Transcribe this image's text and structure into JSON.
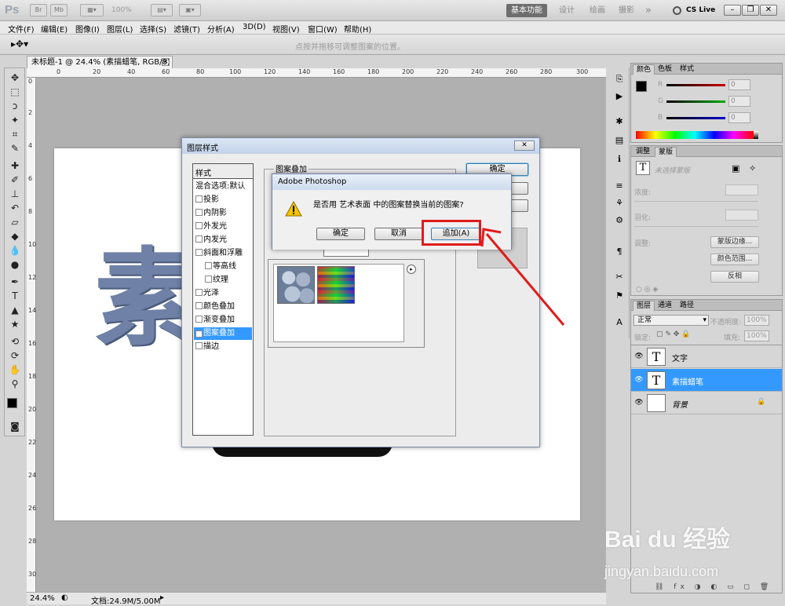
{
  "appbar": {
    "logo": "Ps",
    "zoom": "100%",
    "workspaces": [
      "基本功能",
      "设计",
      "绘画",
      "摄影"
    ],
    "more": "»",
    "cs_live": "CS Live"
  },
  "menu": [
    "文件(F)",
    "编辑(E)",
    "图像(I)",
    "图层(L)",
    "选择(S)",
    "滤镜(T)",
    "分析(A)",
    "3D(D)",
    "视图(V)",
    "窗口(W)",
    "帮助(H)"
  ],
  "options": {
    "hint": "点按并拖移可调整图案的位置。"
  },
  "document": {
    "tab_title": "未标题-1 @ 24.4% (素描蜡笔, RGB/8) *",
    "ruler_h": [
      "0",
      "20",
      "40",
      "60",
      "80",
      "100",
      "120",
      "140",
      "160",
      "180",
      "200",
      "220",
      "240",
      "260",
      "280",
      "300"
    ],
    "ruler_v": [
      "0",
      "2",
      "4",
      "6",
      "8",
      "10",
      "12",
      "14",
      "16",
      "18",
      "20",
      "22",
      "24",
      "26",
      "28",
      "30"
    ],
    "canvas_text": "素"
  },
  "status": {
    "zoom": "24.4%",
    "doc": "文档:24.9M/5.00M"
  },
  "layer_style": {
    "title": "图层样式",
    "styles_header": "样式",
    "items": [
      {
        "label": "混合选项:默认",
        "checkbox": false,
        "checked": false
      },
      {
        "label": "投影",
        "checkbox": true,
        "checked": false
      },
      {
        "label": "内阴影",
        "checkbox": true,
        "checked": false
      },
      {
        "label": "外发光",
        "checkbox": true,
        "checked": false
      },
      {
        "label": "内发光",
        "checkbox": true,
        "checked": false
      },
      {
        "label": "斜面和浮雕",
        "checkbox": true,
        "checked": false
      },
      {
        "label": "等高线",
        "checkbox": true,
        "checked": false
      },
      {
        "label": "纹理",
        "checkbox": true,
        "checked": false
      },
      {
        "label": "光泽",
        "checkbox": true,
        "checked": false
      },
      {
        "label": "颜色叠加",
        "checkbox": true,
        "checked": false
      },
      {
        "label": "渐变叠加",
        "checkbox": true,
        "checked": false
      },
      {
        "label": "图案叠加",
        "checkbox": true,
        "checked": true,
        "selected": true
      },
      {
        "label": "描边",
        "checkbox": true,
        "checked": false
      }
    ],
    "group_title": "图案叠加",
    "ok": "确定"
  },
  "alert": {
    "title": "Adobe Photoshop",
    "message": "是否用 艺术表面 中的图案替换当前的图案?",
    "ok": "确定",
    "cancel": "取消",
    "append": "追加(A)"
  },
  "color_panel": {
    "tabs": [
      "颜色",
      "色板",
      "样式"
    ],
    "channels": [
      {
        "letter": "R",
        "value": "0",
        "color": "#cc0000"
      },
      {
        "letter": "G",
        "value": "0",
        "color": "#00aa00"
      },
      {
        "letter": "B",
        "value": "0",
        "color": "#0000cc"
      }
    ]
  },
  "adjust_panel": {
    "tabs": [
      "调整",
      "蒙版"
    ],
    "no_mask": "未选择蒙版",
    "density": "浓度:",
    "feather": "羽化:",
    "refine": "调整:",
    "btn_mask_edge": "蒙版边缘...",
    "btn_color_range": "颜色范围...",
    "btn_invert": "反相"
  },
  "layers_panel": {
    "tabs": [
      "图层",
      "通道",
      "路径"
    ],
    "blend": "正常",
    "opacity_label": "不透明度:",
    "opacity": "100%",
    "lock_label": "锁定:",
    "fill_label": "填充:",
    "fill": "100%",
    "layers": [
      {
        "name": "文字",
        "thumb": "T",
        "selected": false
      },
      {
        "name": "素描蜡笔",
        "thumb": "T",
        "selected": true
      },
      {
        "name": "背景",
        "thumb": "",
        "selected": false
      }
    ]
  },
  "watermark": {
    "main": "Bai du 经验",
    "sub": "jingyan.baidu.com"
  }
}
